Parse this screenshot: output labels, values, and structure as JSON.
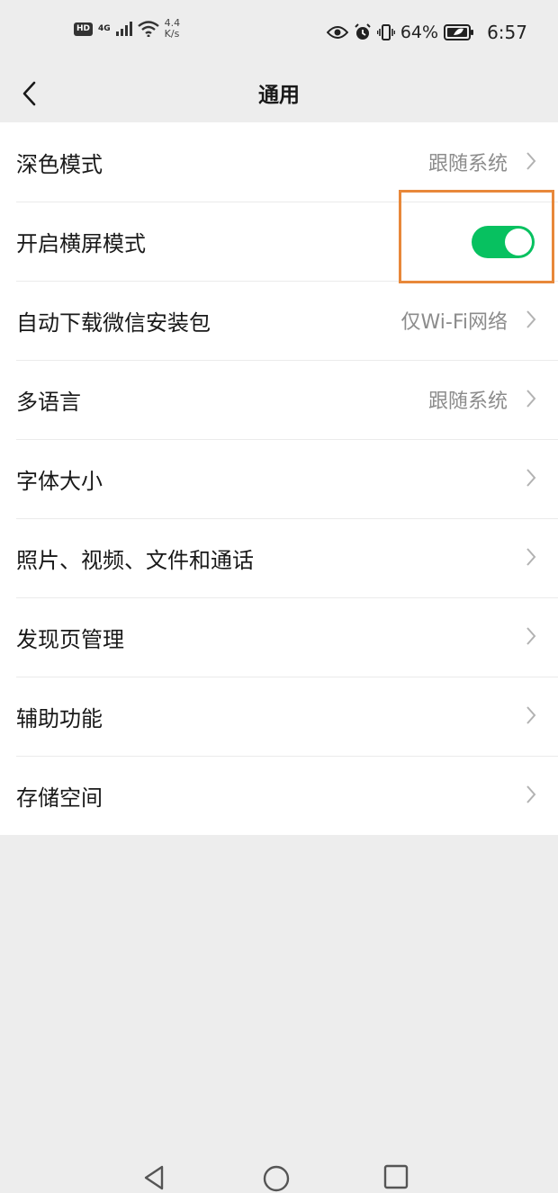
{
  "status_bar": {
    "hd_badge": "HD",
    "network_type": "4G",
    "network_speed_value": "4.4",
    "network_speed_unit": "K/s",
    "battery_percent": "64%",
    "time": "6:57"
  },
  "header": {
    "title": "通用"
  },
  "settings": {
    "items": [
      {
        "label": "深色模式",
        "value": "跟随系统"
      },
      {
        "label": "开启横屏模式",
        "toggle_on": true
      },
      {
        "label": "自动下载微信安装包",
        "value": "仅Wi-Fi网络"
      },
      {
        "label": "多语言",
        "value": "跟随系统"
      },
      {
        "label": "字体大小"
      },
      {
        "label": "照片、视频、文件和通话"
      },
      {
        "label": "发现页管理"
      },
      {
        "label": "辅助功能"
      },
      {
        "label": "存储空间"
      }
    ]
  },
  "colors": {
    "toggle_on": "#07c160",
    "highlight": "#e8883a",
    "page_background": "#ededed"
  }
}
